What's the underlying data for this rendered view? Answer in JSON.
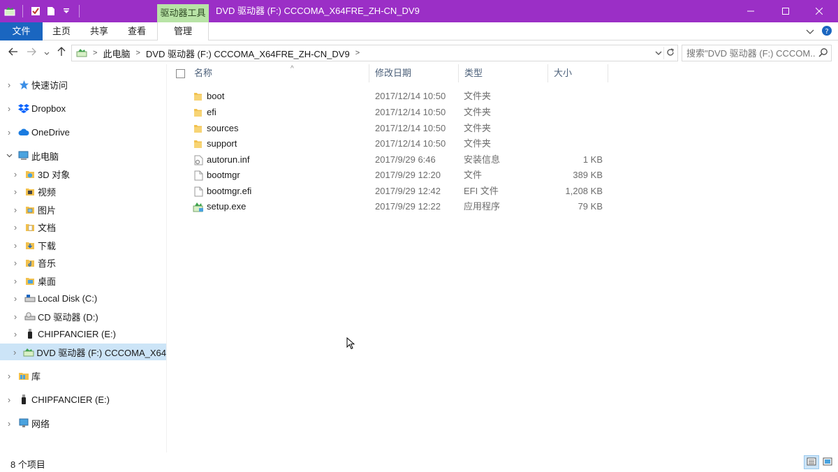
{
  "window": {
    "title": "DVD 驱动器 (F:) CCCOMA_X64FRE_ZH-CN_DV9",
    "context_tab": "驱动器工具",
    "minimize_icon": "minimize-icon",
    "maximize_icon": "maximize-icon",
    "close_icon": "close-icon"
  },
  "ribbon": {
    "tabs": [
      {
        "label": "文件"
      },
      {
        "label": "主页"
      },
      {
        "label": "共享"
      },
      {
        "label": "查看"
      },
      {
        "label": "管理"
      }
    ]
  },
  "address": {
    "crumbs": [
      "此电脑",
      "DVD 驱动器 (F:) CCCOMA_X64FRE_ZH-CN_DV9"
    ]
  },
  "search": {
    "placeholder": "搜索\"DVD 驱动器 (F:) CCCOM..."
  },
  "nav_tree": [
    {
      "label": "快速访问",
      "icon": "star-icon"
    },
    {
      "label": "Dropbox",
      "icon": "dropbox-icon"
    },
    {
      "label": "OneDrive",
      "icon": "cloud-icon"
    },
    {
      "label": "此电脑",
      "icon": "computer-icon"
    },
    {
      "label": "3D 对象",
      "icon": "3d-objects-icon"
    },
    {
      "label": "视频",
      "icon": "video-folder-icon"
    },
    {
      "label": "图片",
      "icon": "pictures-folder-icon"
    },
    {
      "label": "文档",
      "icon": "documents-folder-icon"
    },
    {
      "label": "下载",
      "icon": "downloads-folder-icon"
    },
    {
      "label": "音乐",
      "icon": "music-folder-icon"
    },
    {
      "label": "桌面",
      "icon": "desktop-folder-icon"
    },
    {
      "label": "Local Disk (C:)",
      "icon": "hard-drive-icon"
    },
    {
      "label": "CD 驱动器 (D:)",
      "icon": "cd-drive-icon"
    },
    {
      "label": "CHIPFANCIER (E:)",
      "icon": "usb-drive-icon"
    },
    {
      "label": "DVD 驱动器 (F:) CCCOMA_X64",
      "icon": "dvd-drive-icon"
    },
    {
      "label": "库",
      "icon": "library-icon"
    },
    {
      "label": "CHIPFANCIER (E:)",
      "icon": "usb-drive-icon"
    },
    {
      "label": "网络",
      "icon": "network-icon"
    }
  ],
  "columns": {
    "name": "名称",
    "date": "修改日期",
    "type": "类型",
    "size": "大小"
  },
  "files": [
    {
      "name": "boot",
      "date": "2017/12/14 10:50",
      "type": "文件夹",
      "size": "",
      "icon": "folder-icon"
    },
    {
      "name": "efi",
      "date": "2017/12/14 10:50",
      "type": "文件夹",
      "size": "",
      "icon": "folder-icon"
    },
    {
      "name": "sources",
      "date": "2017/12/14 10:50",
      "type": "文件夹",
      "size": "",
      "icon": "folder-icon"
    },
    {
      "name": "support",
      "date": "2017/12/14 10:50",
      "type": "文件夹",
      "size": "",
      "icon": "folder-icon"
    },
    {
      "name": "autorun.inf",
      "date": "2017/9/29 6:46",
      "type": "安装信息",
      "size": "1 KB",
      "icon": "settings-file-icon"
    },
    {
      "name": "bootmgr",
      "date": "2017/9/29 12:20",
      "type": "文件",
      "size": "389 KB",
      "icon": "file-icon"
    },
    {
      "name": "bootmgr.efi",
      "date": "2017/9/29 12:42",
      "type": "EFI 文件",
      "size": "1,208 KB",
      "icon": "file-icon"
    },
    {
      "name": "setup.exe",
      "date": "2017/9/29 12:22",
      "type": "应用程序",
      "size": "79 KB",
      "icon": "setup-exe-icon"
    }
  ],
  "status": {
    "item_count": "8 个项目"
  },
  "colors": {
    "titlebar": "#9b2fc6",
    "file_tab": "#1a66c0",
    "context_tab": "#b8e3a6",
    "selection": "#cce4f7",
    "folder": "#f2c14e"
  }
}
